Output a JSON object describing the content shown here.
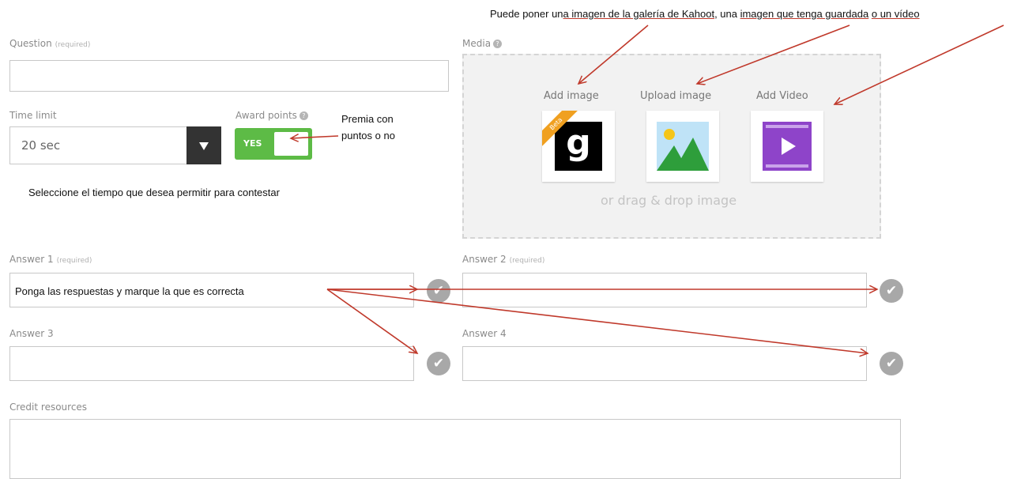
{
  "question": {
    "label": "Question",
    "required": "(required)",
    "value": ""
  },
  "media": {
    "label": "Media",
    "info_icon": "info-icon",
    "add_image": "Add image",
    "upload_image": "Upload image",
    "add_video": "Add Video",
    "beta": "Beta",
    "gallery_logo_letter": "g",
    "drag_drop": "or drag & drop image"
  },
  "time_limit": {
    "label": "Time limit",
    "value": "20 sec"
  },
  "award_points": {
    "label": "Award points",
    "toggle": "YES",
    "state": "on"
  },
  "answers": {
    "a1": {
      "label": "Answer 1",
      "required": "(required)",
      "value": ""
    },
    "a2": {
      "label": "Answer 2",
      "required": "(required)",
      "value": ""
    },
    "a3": {
      "label": "Answer 3",
      "value": ""
    },
    "a4": {
      "label": "Answer 4",
      "value": ""
    }
  },
  "credit": {
    "label": "Credit resources",
    "value": ""
  },
  "annotations": {
    "top_prefix": "Puede poner un",
    "top_link1": "a imagen de la galería de Kahoot",
    "top_mid1": ", una ",
    "top_link2": "imagen que tenga guardada",
    "top_mid2": " ",
    "top_link3": "o un vídeo",
    "award_note_line1": "Premia con",
    "award_note_line2": "puntos o no",
    "time_note": "Seleccione el tiempo que desea permitir para contestar",
    "answers_note": "Ponga las respuestas y marque la que es correcta"
  },
  "colors": {
    "accent_green": "#5dbb46",
    "arrow_red": "#c0392b",
    "video_purple": "#8e44c9",
    "dark": "#333333"
  }
}
